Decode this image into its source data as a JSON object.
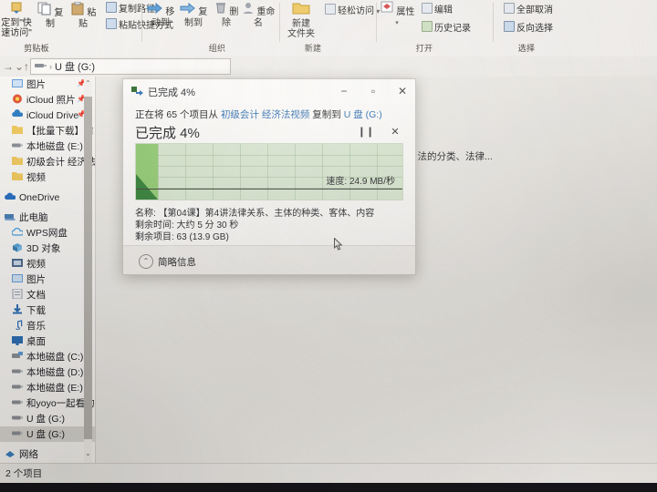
{
  "ribbon": {
    "groups": [
      {
        "caption": "剪贴板"
      },
      {
        "caption": "组织"
      },
      {
        "caption": "新建"
      },
      {
        "caption": "打开"
      },
      {
        "caption": "选择"
      }
    ],
    "clipboard": {
      "pin_label_1": "定到\"快",
      "pin_label_2": "速访问\"",
      "copy": "复制",
      "paste": "粘贴",
      "copy_path": "复制路径",
      "paste_shortcut": "粘贴快捷方式"
    },
    "organize": {
      "move_to": "移动到",
      "copy_to": "复制到",
      "delete": "删除",
      "rename": "重命名"
    },
    "new": {
      "new_folder_line1": "新建",
      "new_folder_line2": "文件夹",
      "easy_access": "轻松访问"
    },
    "open": {
      "properties": "属性",
      "edit": "编辑",
      "history": "历史记录"
    },
    "select": {
      "select_none": "全部取消",
      "invert_selection": "反向选择"
    }
  },
  "addressbar": {
    "forward_icon": "→",
    "recent_icon": "⌄",
    "up_icon": "↑",
    "drive_icon": "usb-drive-icon",
    "separator": "›",
    "path": "U 盘 (G:)"
  },
  "sidebar": {
    "items": [
      {
        "label": "图片",
        "icon": "picture-icon",
        "indent": 1,
        "pinned": true,
        "selected": false
      },
      {
        "label": "iCloud 照片",
        "icon": "icloud-photos-icon",
        "indent": 1,
        "pinned": true,
        "selected": false
      },
      {
        "label": "iCloud Drive",
        "icon": "icloud-drive-icon",
        "indent": 1,
        "pinned": true,
        "selected": false
      },
      {
        "label": "【批量下载】前",
        "icon": "folder-icon",
        "indent": 1,
        "pinned": false,
        "selected": false
      },
      {
        "label": "本地磁盘 (E:)",
        "icon": "drive-icon",
        "indent": 1,
        "pinned": false,
        "selected": false
      },
      {
        "label": "初级会计 经济法",
        "icon": "folder-icon",
        "indent": 1,
        "pinned": false,
        "selected": false
      },
      {
        "label": "视频",
        "icon": "folder-icon",
        "indent": 1,
        "pinned": false,
        "selected": false
      },
      {
        "label": "OneDrive",
        "icon": "onedrive-icon",
        "indent": 0,
        "pinned": false,
        "selected": false
      },
      {
        "label": "此电脑",
        "icon": "this-pc-icon",
        "indent": 0,
        "pinned": false,
        "selected": false
      },
      {
        "label": "WPS网盘",
        "icon": "wps-cloud-icon",
        "indent": 1,
        "pinned": false,
        "selected": false
      },
      {
        "label": "3D 对象",
        "icon": "3d-objects-icon",
        "indent": 1,
        "pinned": false,
        "selected": false
      },
      {
        "label": "视频",
        "icon": "videos-icon",
        "indent": 1,
        "pinned": false,
        "selected": false
      },
      {
        "label": "图片",
        "icon": "pictures-icon",
        "indent": 1,
        "pinned": false,
        "selected": false
      },
      {
        "label": "文档",
        "icon": "documents-icon",
        "indent": 1,
        "pinned": false,
        "selected": false
      },
      {
        "label": "下载",
        "icon": "downloads-icon",
        "indent": 1,
        "pinned": false,
        "selected": false
      },
      {
        "label": "音乐",
        "icon": "music-icon",
        "indent": 1,
        "pinned": false,
        "selected": false
      },
      {
        "label": "桌面",
        "icon": "desktop-icon",
        "indent": 1,
        "pinned": false,
        "selected": false
      },
      {
        "label": "本地磁盘 (C:)",
        "icon": "system-drive-icon",
        "indent": 1,
        "pinned": false,
        "selected": false
      },
      {
        "label": "本地磁盘 (D:)",
        "icon": "drive-icon",
        "indent": 1,
        "pinned": false,
        "selected": false
      },
      {
        "label": "本地磁盘 (E:)",
        "icon": "drive-icon",
        "indent": 1,
        "pinned": false,
        "selected": false
      },
      {
        "label": "和yoyo一起看的",
        "icon": "drive-icon",
        "indent": 1,
        "pinned": false,
        "selected": false
      },
      {
        "label": "U 盘 (G:)",
        "icon": "drive-icon",
        "indent": 1,
        "pinned": false,
        "selected": false
      },
      {
        "label": "U 盘 (G:)",
        "icon": "drive-icon",
        "indent": 1,
        "pinned": false,
        "selected": true
      },
      {
        "label": "网络",
        "icon": "network-icon",
        "indent": 0,
        "pinned": false,
        "selected": false
      }
    ],
    "scroll_up_icon": "⌃",
    "scroll_down_icon": "⌄"
  },
  "content": {
    "file_name_fragment": "、法的分类、法律..."
  },
  "statusbar": {
    "item_count": "2 个项目"
  },
  "dialog": {
    "title": "已完成 4%",
    "title_icon": "copy-icon",
    "minimize": "−",
    "maximize": "▫",
    "close": "✕",
    "from_prefix": "正在将 65 个项目从",
    "source_1": "初级会计",
    "source_2": "经济法视频",
    "to_word": "复制到",
    "dest_1": "U 盘",
    "dest_2": "(G:)",
    "percent_text": "已完成 4%",
    "pause_icon": "❙❙",
    "stop_icon": "✕",
    "speed_label": "速度: 24.9 MB/秒",
    "name_line": "名称: 【第04课】第4讲法律关系、主体的种类、客体、内容",
    "time_line": "剩余时间: 大约 5 分 30 秒",
    "items_line": "剩余项目: 63 (13.9 GB)",
    "footer_label": "简略信息",
    "footer_chevron": "⌃",
    "progress_percent": 4,
    "accent_color": "#2b6cb0",
    "graph_bg_color": "#d7e6cf",
    "graph_light_green": "#8fca6e",
    "graph_dark_green": "#2f7d32"
  }
}
